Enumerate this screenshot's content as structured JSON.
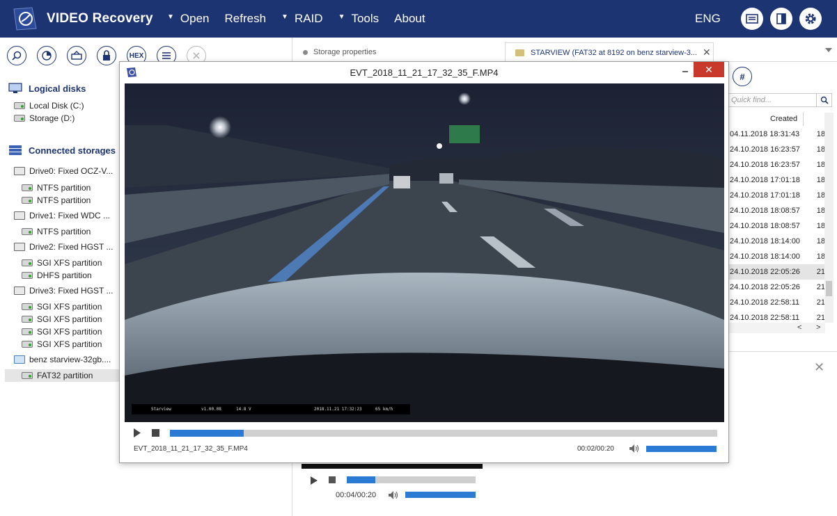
{
  "app": {
    "title": "VIDEO Recovery",
    "language": "ENG",
    "menu": [
      {
        "label": "Open",
        "has_arrow": true
      },
      {
        "label": "Refresh",
        "has_arrow": false
      },
      {
        "label": "RAID",
        "has_arrow": true
      },
      {
        "label": "Tools",
        "has_arrow": true
      },
      {
        "label": "About",
        "has_arrow": false
      }
    ],
    "menu_arrow": "▼",
    "top_icons": [
      "ribbon-icon",
      "panel-icon",
      "gear-icon"
    ],
    "brand_color": "#1d3473"
  },
  "toolbar": {
    "hex_label": "HEX",
    "icons": [
      "zoom-icon",
      "scan-icon",
      "image-icon",
      "lock-icon",
      "hex-icon",
      "list-icon",
      "close-icon"
    ]
  },
  "left": {
    "logical_disks_title": "Logical disks",
    "logical_disks": [
      "Local Disk (C:)",
      "Storage (D:)"
    ],
    "connected_title": "Connected storages",
    "drives": [
      {
        "label": "Drive0: Fixed OCZ-V...",
        "partitions": [
          "NTFS partition",
          "NTFS partition"
        ]
      },
      {
        "label": "Drive1: Fixed WDC ...",
        "partitions": [
          "NTFS partition"
        ]
      },
      {
        "label": "Drive2: Fixed HGST ...",
        "partitions": [
          "SGI XFS partition",
          "DHFS partition"
        ]
      },
      {
        "label": "Drive3: Fixed HGST ...",
        "partitions": [
          "SGI XFS partition",
          "SGI XFS partition",
          "SGI XFS partition",
          "SGI XFS partition"
        ]
      },
      {
        "label": "benz starview-32gb....",
        "partitions": [
          "FAT32 partition"
        ]
      }
    ]
  },
  "tabs": [
    {
      "label": "Storage properties",
      "active": false
    },
    {
      "label": "STARVIEW (FAT32 at 8192 on benz starview-3...",
      "active": true
    }
  ],
  "file_list": {
    "hash_label": "#",
    "quick_find_placeholder": "Quick find...",
    "column_created": "Created",
    "rows": [
      {
        "created": "04.11.2018 18:31:43",
        "next": "18",
        "selected": false
      },
      {
        "created": "24.10.2018 16:23:57",
        "next": "18",
        "selected": false
      },
      {
        "created": "24.10.2018 16:23:57",
        "next": "18",
        "selected": false
      },
      {
        "created": "24.10.2018 17:01:18",
        "next": "18",
        "selected": false
      },
      {
        "created": "24.10.2018 17:01:18",
        "next": "18",
        "selected": false
      },
      {
        "created": "24.10.2018 18:08:57",
        "next": "18",
        "selected": false
      },
      {
        "created": "24.10.2018 18:08:57",
        "next": "18",
        "selected": false
      },
      {
        "created": "24.10.2018 18:14:00",
        "next": "18",
        "selected": false
      },
      {
        "created": "24.10.2018 18:14:00",
        "next": "18",
        "selected": false
      },
      {
        "created": "24.10.2018 22:05:26",
        "next": "21",
        "selected": true
      },
      {
        "created": "24.10.2018 22:05:26",
        "next": "21",
        "selected": false
      },
      {
        "created": "24.10.2018 22:58:11",
        "next": "21",
        "selected": false
      },
      {
        "created": "24.10.2018 22:58:11",
        "next": "21",
        "selected": false
      }
    ],
    "scroll_left": "<",
    "scroll_right": ">",
    "panel_close": "✕"
  },
  "bg_player": {
    "time": "00:04/00:20",
    "progress": 0.22,
    "volume": 1.0
  },
  "video_window": {
    "title": "EVT_2018_11_21_17_32_35_F.MP4",
    "filename": "EVT_2018_11_21_17_32_35_F.MP4",
    "time": "00:02/00:20",
    "progress": 0.135,
    "volume": 1.0,
    "close_symbol": "✕",
    "osd": {
      "brand": "Starview",
      "version": "v1.00.08",
      "voltage": "14.8 V",
      "datetime": "2018.11.21 17:32:23",
      "speed": "65 km/h"
    },
    "sign_color": "#2f7a4a"
  }
}
